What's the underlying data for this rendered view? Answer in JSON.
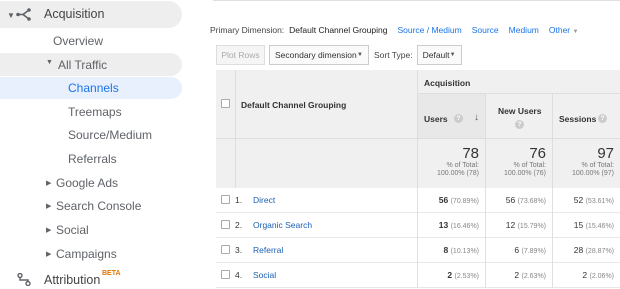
{
  "sidebar": {
    "acquisition": "Acquisition",
    "overview": "Overview",
    "all_traffic": "All Traffic",
    "channels": "Channels",
    "treemaps": "Treemaps",
    "source_medium": "Source/Medium",
    "referrals": "Referrals",
    "google_ads": "Google Ads",
    "search_console": "Search Console",
    "social": "Social",
    "campaigns": "Campaigns",
    "attribution": "Attribution",
    "attribution_badge": "BETA"
  },
  "primary_dimension": {
    "label": "Primary Dimension:",
    "selected": "Default Channel Grouping",
    "links": [
      "Source / Medium",
      "Source",
      "Medium"
    ],
    "other": "Other"
  },
  "toolbar": {
    "plot_rows": "Plot Rows",
    "secondary_dimension": "Secondary dimension",
    "sort_type_label": "Sort Type:",
    "sort_type_value": "Default"
  },
  "table": {
    "dimension_header": "Default Channel Grouping",
    "group_header": "Acquisition",
    "columns": {
      "users": "Users",
      "new_users": "New Users",
      "sessions": "Sessions"
    },
    "totals": {
      "users": {
        "value": "78",
        "pct": "% of Total:",
        "detail": "100.00% (78)"
      },
      "new_users": {
        "value": "76",
        "pct": "% of Total:",
        "detail": "100.00% (76)"
      },
      "sessions": {
        "value": "97",
        "pct": "% of Total:",
        "detail": "100.00% (97)"
      }
    },
    "rows": [
      {
        "num": "1.",
        "name": "Direct",
        "users": "56",
        "users_pct": "(70.89%)",
        "new_users": "56",
        "new_users_pct": "(73.68%)",
        "sessions": "52",
        "sessions_pct": "(53.61%)"
      },
      {
        "num": "2.",
        "name": "Organic Search",
        "users": "13",
        "users_pct": "(16.46%)",
        "new_users": "12",
        "new_users_pct": "(15.79%)",
        "sessions": "15",
        "sessions_pct": "(15.46%)"
      },
      {
        "num": "3.",
        "name": "Referral",
        "users": "8",
        "users_pct": "(10.13%)",
        "new_users": "6",
        "new_users_pct": "(7.89%)",
        "sessions": "28",
        "sessions_pct": "(28.87%)"
      },
      {
        "num": "4.",
        "name": "Social",
        "users": "2",
        "users_pct": "(2.53%)",
        "new_users": "2",
        "new_users_pct": "(2.63%)",
        "sessions": "2",
        "sessions_pct": "(2.06%)"
      }
    ]
  },
  "colors": {
    "accent": "#1a73e8",
    "link": "#1a5fb4",
    "active_bg": "#e8f0fe",
    "badge": "#e37400"
  }
}
